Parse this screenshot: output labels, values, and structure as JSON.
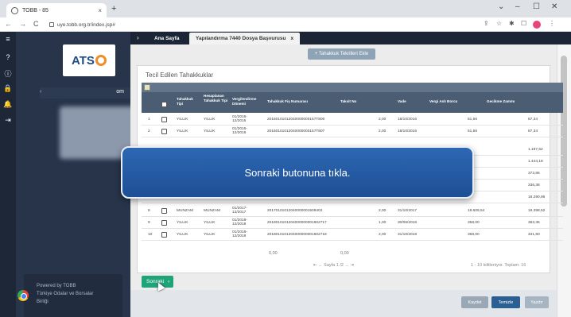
{
  "browser": {
    "tab_title": "TOBB - 85",
    "tab_close": "×",
    "new_tab": "+",
    "url": "uye.tobb.org.tr/index.jsp#",
    "window_controls": [
      "⌄",
      "–",
      "☐",
      "✕"
    ],
    "nav": [
      "←",
      "→",
      "C"
    ],
    "addr_icons": [
      "⇪",
      "☆",
      "✱",
      "☐",
      "⋮"
    ]
  },
  "rail": {
    "icons": [
      "≡",
      "?",
      "ⓘ",
      "🔒",
      "🔔",
      "⇥"
    ]
  },
  "sidebar": {
    "logo": "ATS",
    "user_suffix": "om",
    "user_arrow": "‹",
    "powered_lines": [
      "Powered by TOBB",
      "Türkiye Odalar ve Borsalar",
      "Birliği"
    ]
  },
  "tabs": {
    "arrow": "›",
    "home": "Ana Sayfa",
    "active": "Yapılandırma 7440 Dosya Başvurusu",
    "active_close": "x"
  },
  "top_button": "+ Tahakkuk Tekrilleri Ekle",
  "panel_title": "Tecil Edilen Tahakkuklar",
  "grid": {
    "headers": [
      "Tahakkuk Tipi",
      "Hesaplanan Tahakkuk Tipi",
      "Vergilendirme Dönemi",
      "Tahakkuk Fiş Numarası",
      "Taksit No",
      "Vade",
      "Vergi Aslı Borcu",
      "Gecikme Zammı"
    ],
    "rows": [
      {
        "no": "1",
        "tip": "YILLIK",
        "htip": "YILLIK",
        "donem": "01/2016-12/2016",
        "fis": "20160101012040000000157T800",
        "taksit": "2,00",
        "vade": "18/10/2016",
        "borc": "51,66",
        "zam": "87,34"
      },
      {
        "no": "2",
        "tip": "YILLIK",
        "htip": "YILLIK",
        "donem": "01/2016-12/2016",
        "fis": "20160101012040000000157T807",
        "taksit": "2,00",
        "vade": "18/10/2016",
        "borc": "51,66",
        "zam": "87,34"
      },
      {
        "no": "",
        "tip": "",
        "htip": "",
        "donem": "",
        "fis": "",
        "taksit": "",
        "vade": "",
        "borc": "",
        "zam": "1.197,62"
      },
      {
        "no": "",
        "tip": "",
        "htip": "",
        "donem": "",
        "fis": "",
        "taksit": "",
        "vade": "",
        "borc": "",
        "zam": "1.444,18"
      },
      {
        "no": "",
        "tip": "",
        "htip": "",
        "donem": "",
        "fis": "",
        "taksit": "",
        "vade": "",
        "borc": "",
        "zam": "373,86"
      },
      {
        "no": "",
        "tip": "",
        "htip": "",
        "donem": "",
        "fis": "",
        "taksit": "",
        "vade": "",
        "borc": "",
        "zam": "336,38"
      },
      {
        "no": "",
        "tip": "",
        "htip": "",
        "donem": "",
        "fis": "",
        "taksit": "",
        "vade": "",
        "borc": "",
        "zam": "18.290,96"
      },
      {
        "no": "8",
        "tip": "MUNZAM",
        "htip": "MUNZAM",
        "donem": "01/2017-12/2017",
        "fis": "20170101012040000001509402",
        "taksit": "2,00",
        "vade": "31/10/2017",
        "borc": "18.609,54",
        "zam": "18.398,52"
      },
      {
        "no": "9",
        "tip": "YILLIK",
        "htip": "YILLIK",
        "donem": "01/2018-12/2018",
        "fis": "2018010101204000000001602717",
        "taksit": "1,00",
        "vade": "30/06/2018",
        "borc": "358,00",
        "zam": "363,36"
      },
      {
        "no": "10",
        "tip": "YILLIK",
        "htip": "YILLIK",
        "donem": "01/2018-12/2018",
        "fis": "2018010101204000000001602718",
        "taksit": "2,00",
        "vade": "31/10/2018",
        "borc": "358,00",
        "zam": "341,60"
      }
    ],
    "total_left": "0,00",
    "total_right": "0,00",
    "pager": "⇤ ← Sayfa 1 /2 → ⇥",
    "pager_info": "1 - 10 kilitleniyor. Toplam: 16"
  },
  "next_button": "Sonraki",
  "footer_buttons": [
    "Kaydet",
    "Temizle",
    "Yazdır"
  ],
  "overlay_text": "Sonraki butonuna tıkla.",
  "colors": {
    "header": "#4a5d73",
    "green": "#1fa47a",
    "sidebar": "#27344a",
    "overlay": "#2d67b3"
  }
}
